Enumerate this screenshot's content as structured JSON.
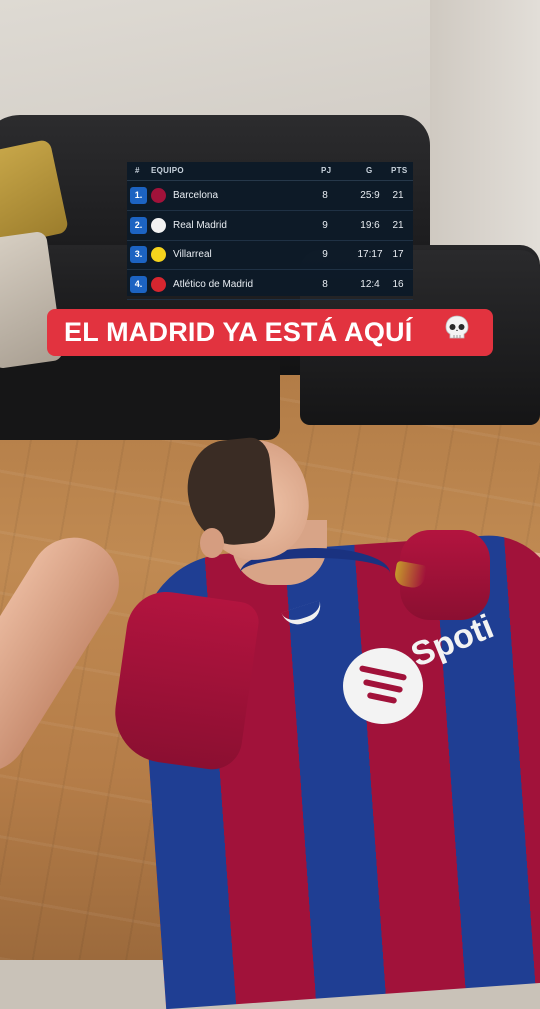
{
  "standings": {
    "headers": {
      "pos": "#",
      "team": "EQUIPO",
      "played": "PJ",
      "goals": "G",
      "points": "PTS"
    },
    "rows": [
      {
        "position": "1.",
        "team": "Barcelona",
        "played": "8",
        "goals": "25:9",
        "points": "21",
        "crest_color": "#a1123a",
        "crest_icon": "barcelona-crest"
      },
      {
        "position": "2.",
        "team": "Real Madrid",
        "played": "9",
        "goals": "19:6",
        "points": "21",
        "crest_color": "#f2f2f2",
        "crest_icon": "real-madrid-crest"
      },
      {
        "position": "3.",
        "team": "Villarreal",
        "played": "9",
        "goals": "17:17",
        "points": "17",
        "crest_color": "#f5d31d",
        "crest_icon": "villarreal-crest"
      },
      {
        "position": "4.",
        "team": "Atlético de Madrid",
        "played": "8",
        "goals": "12:4",
        "points": "16",
        "crest_color": "#d6262f",
        "crest_icon": "atletico-crest"
      }
    ],
    "position_badge_color": "#1c63c2"
  },
  "caption": {
    "text": "EL MADRID YA ESTÁ AQUÍ",
    "emoji": "skull-emoji",
    "background": "#e2333f"
  },
  "jersey": {
    "sponsor": "Spoti"
  }
}
